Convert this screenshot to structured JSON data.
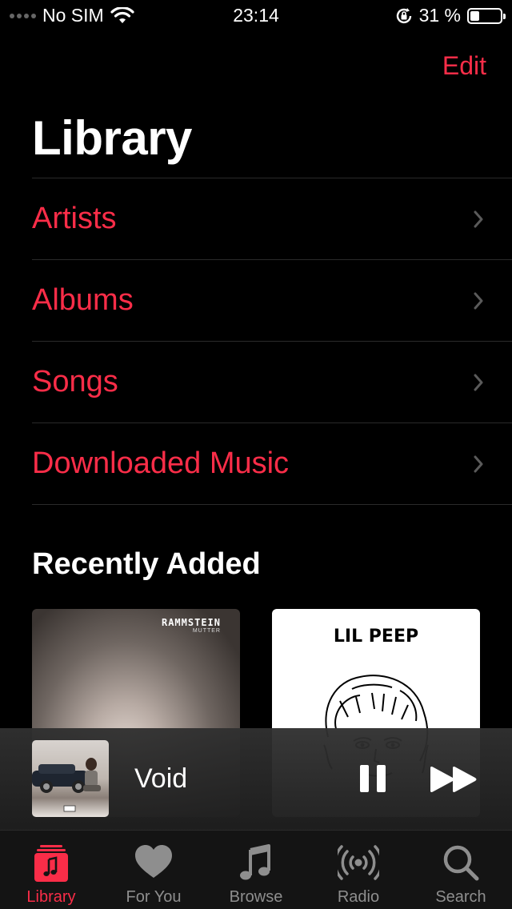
{
  "status_bar": {
    "carrier": "No SIM",
    "time": "23:14",
    "battery_percent": "31 %",
    "battery_level": 0.31
  },
  "header": {
    "edit_label": "Edit",
    "title": "Library"
  },
  "menu": {
    "items": [
      {
        "label": "Artists"
      },
      {
        "label": "Albums"
      },
      {
        "label": "Songs"
      },
      {
        "label": "Downloaded Music"
      }
    ]
  },
  "recently_added": {
    "title": "Recently Added",
    "albums": [
      {
        "artwork_text": "RAMMSTEIN",
        "artwork_subtext": "MUTTER"
      },
      {
        "artwork_text": "LIL PEEP"
      }
    ]
  },
  "now_playing": {
    "title": "Void"
  },
  "tab_bar": {
    "tabs": [
      {
        "label": "Library",
        "icon": "library-icon",
        "active": true
      },
      {
        "label": "For You",
        "icon": "heart-icon",
        "active": false
      },
      {
        "label": "Browse",
        "icon": "music-note-icon",
        "active": false
      },
      {
        "label": "Radio",
        "icon": "radio-icon",
        "active": false
      },
      {
        "label": "Search",
        "icon": "search-icon",
        "active": false
      }
    ]
  },
  "colors": {
    "accent": "#fa2d48",
    "background": "#000000",
    "inactive_tab": "#8e8e8e"
  }
}
